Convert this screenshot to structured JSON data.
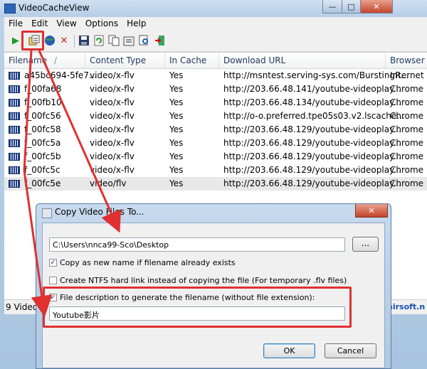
{
  "window": {
    "title": "VideoCacheView"
  },
  "menu": [
    "File",
    "Edit",
    "View",
    "Options",
    "Help"
  ],
  "toolbar_icons": [
    "play-icon",
    "copy-files-icon",
    "globe-icon",
    "delete-icon",
    "save-icon",
    "refresh-icon",
    "copy-icon",
    "properties-icon",
    "search-icon",
    "exit-icon"
  ],
  "columns": [
    "Filename",
    "Content Type",
    "In Cache",
    "Download URL",
    "Browser"
  ],
  "sort_indicator": "/",
  "rows": [
    {
      "filename": "a45bc694-5fe7...",
      "type": "video/x-flv",
      "cache": "Yes",
      "url": "http://msntest.serving-sys.com/BurstingR...",
      "browser": "Internet"
    },
    {
      "filename": "f_00fa68",
      "type": "video/x-flv",
      "cache": "Yes",
      "url": "http://203.66.48.141/youtube-videoplay...",
      "browser": "Chrome"
    },
    {
      "filename": "f_00fb10",
      "type": "video/x-flv",
      "cache": "Yes",
      "url": "http://203.66.48.134/youtube-videoplay...",
      "browser": "Chrome"
    },
    {
      "filename": "f_00fc56",
      "type": "video/x-flv",
      "cache": "Yes",
      "url": "http://o-o.preferred.tpe05s03.v2.lscache...",
      "browser": "Chrome"
    },
    {
      "filename": "f_00fc58",
      "type": "video/x-flv",
      "cache": "Yes",
      "url": "http://203.66.48.129/youtube-videoplay...",
      "browser": "Chrome"
    },
    {
      "filename": "f_00fc5a",
      "type": "video/x-flv",
      "cache": "Yes",
      "url": "http://203.66.48.129/youtube-videoplay...",
      "browser": "Chrome"
    },
    {
      "filename": "f_00fc5b",
      "type": "video/x-flv",
      "cache": "Yes",
      "url": "http://203.66.48.129/youtube-videoplay...",
      "browser": "Chrome"
    },
    {
      "filename": "f_00fc5c",
      "type": "video/x-flv",
      "cache": "Yes",
      "url": "http://203.66.48.129/youtube-videoplay...",
      "browser": "Chrome"
    },
    {
      "filename": "f_00fc5e",
      "type": "video/flv",
      "cache": "Yes",
      "url": "http://203.66.48.129/youtube-videoplay...",
      "browser": "Chrome"
    }
  ],
  "status": {
    "count_text": "9 Video",
    "link_text": "hirsoft.n"
  },
  "dialog": {
    "title": "Copy Video Files To...",
    "path_value": "C:\\Users\\nnca99-Sco\\Desktop",
    "browse_label": "...",
    "opt_copy_new_name": "Copy as new name if filename already exists",
    "opt_ntfs_link": "Create NTFS hard link instead of copying the file (For temporary .flv files)",
    "opt_file_desc": "File description to generate the filename (without file extension):",
    "desc_value": "Youtube影片",
    "ok_label": "OK",
    "cancel_label": "Cancel",
    "checked": {
      "copy_new_name": true,
      "ntfs_link": false,
      "file_desc": true
    }
  },
  "colors": {
    "highlight": "#e03030",
    "link": "#1a4fb5"
  }
}
